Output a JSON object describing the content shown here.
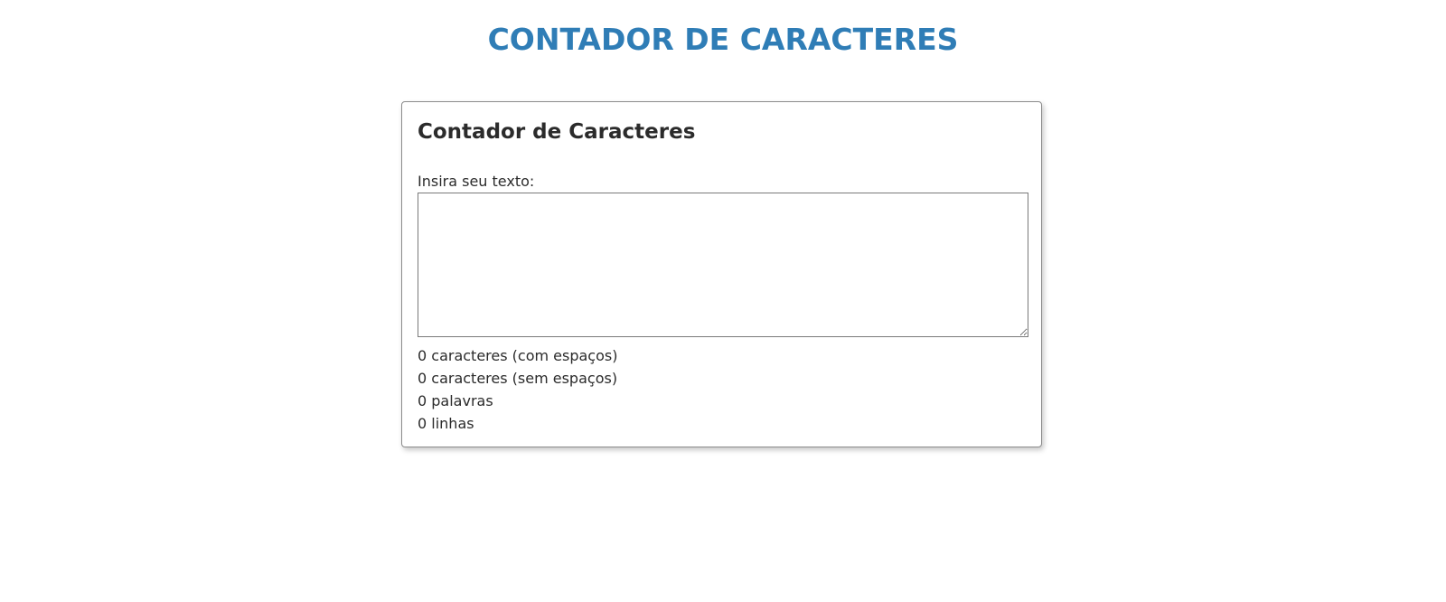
{
  "header": {
    "title": "CONTADOR DE CARACTERES"
  },
  "card": {
    "title": "Contador de Caracteres",
    "input_label": "Insira seu texto:",
    "textarea_value": "",
    "stats": [
      "0 caracteres (com espaços)",
      "0 caracteres (sem espaços)",
      "0 palavras",
      "0 linhas"
    ]
  },
  "colors": {
    "title": "#2f7db6",
    "text": "#2b2b2b",
    "border": "#8c8c8c"
  }
}
